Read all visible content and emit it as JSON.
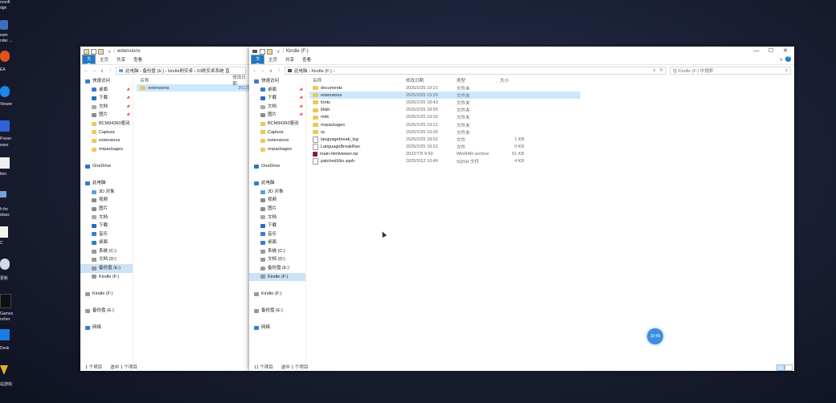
{
  "desktop": {
    "labels": [
      "rosoft",
      "dge",
      "eam",
      "nder ...",
      "EA",
      "Viewer",
      "Power",
      "wser",
      "tion",
      "h for",
      "dows",
      "C",
      "更新",
      "Games",
      "ncher",
      "Desk",
      "站游戏"
    ]
  },
  "left_window": {
    "title": "extensions",
    "ribbon_tabs": [
      "文件",
      "主页",
      "共享",
      "查看"
    ],
    "address": "此电脑 › 备份盘 (E:) › kindle刷安卓 › 03刷安卓系统 直",
    "col_name": "名称",
    "col_date": "修改日期",
    "rows": [
      {
        "name": "extensions",
        "date": "2017/"
      }
    ],
    "sidebar": [
      {
        "label": "快速访问",
        "icon": "star-icon",
        "color": "#3a7bd5",
        "pin": false,
        "level": 0,
        "sel": false
      },
      {
        "label": "桌面",
        "icon": "desktop-icon",
        "color": "#3a7bd5",
        "pin": true,
        "level": 1,
        "sel": false
      },
      {
        "label": "下载",
        "icon": "download-icon",
        "color": "#2b6cc4",
        "pin": true,
        "level": 1,
        "sel": false
      },
      {
        "label": "文档",
        "icon": "document-icon",
        "color": "#aaaaaa",
        "pin": true,
        "level": 1,
        "sel": false
      },
      {
        "label": "图片",
        "icon": "picture-icon",
        "color": "#8a8a8a",
        "pin": true,
        "level": 1,
        "sel": false
      },
      {
        "label": "BCM94360驱动",
        "icon": "folder-icon",
        "color": "#f0c65a",
        "pin": false,
        "level": 1,
        "sel": false
      },
      {
        "label": "Captura",
        "icon": "folder-icon",
        "color": "#f0c65a",
        "pin": false,
        "level": 1,
        "sel": false
      },
      {
        "label": "extensions",
        "icon": "folder-icon",
        "color": "#f0c65a",
        "pin": false,
        "level": 1,
        "sel": false
      },
      {
        "label": "mrpackages",
        "icon": "folder-icon",
        "color": "#f0c65a",
        "pin": false,
        "level": 1,
        "sel": false
      },
      {
        "label": "",
        "icon": "",
        "color": "",
        "pin": false,
        "level": 0,
        "sel": false
      },
      {
        "label": "OneDrive",
        "icon": "cloud-icon",
        "color": "#2a73c9",
        "pin": false,
        "level": 0,
        "sel": false
      },
      {
        "label": "",
        "icon": "",
        "color": "",
        "pin": false,
        "level": 0,
        "sel": false
      },
      {
        "label": "此电脑",
        "icon": "computer-icon",
        "color": "#3a7bd5",
        "pin": false,
        "level": 0,
        "sel": false
      },
      {
        "label": "3D 对象",
        "icon": "cube-icon",
        "color": "#5aa0e0",
        "pin": false,
        "level": 1,
        "sel": false
      },
      {
        "label": "视频",
        "icon": "video-icon",
        "color": "#8a8a8a",
        "pin": false,
        "level": 1,
        "sel": false
      },
      {
        "label": "图片",
        "icon": "picture-icon",
        "color": "#8a8a8a",
        "pin": false,
        "level": 1,
        "sel": false
      },
      {
        "label": "文档",
        "icon": "document-icon",
        "color": "#aaaaaa",
        "pin": false,
        "level": 1,
        "sel": false
      },
      {
        "label": "下载",
        "icon": "download-icon",
        "color": "#2b6cc4",
        "pin": false,
        "level": 1,
        "sel": false
      },
      {
        "label": "音乐",
        "icon": "music-icon",
        "color": "#3a7bd5",
        "pin": false,
        "level": 1,
        "sel": false
      },
      {
        "label": "桌面",
        "icon": "desktop-icon",
        "color": "#3a7bd5",
        "pin": false,
        "level": 1,
        "sel": false
      },
      {
        "label": "系统 (C:)",
        "icon": "drive-icon",
        "color": "#999999",
        "pin": false,
        "level": 1,
        "sel": false
      },
      {
        "label": "文档 (D:)",
        "icon": "drive-icon",
        "color": "#999999",
        "pin": false,
        "level": 1,
        "sel": false
      },
      {
        "label": "备份盘 (E:)",
        "icon": "drive-icon",
        "color": "#999999",
        "pin": false,
        "level": 1,
        "sel": true
      },
      {
        "label": "Kindle (F:)",
        "icon": "drive-icon",
        "color": "#999999",
        "pin": false,
        "level": 1,
        "sel": false
      },
      {
        "label": "",
        "icon": "",
        "color": "",
        "pin": false,
        "level": 0,
        "sel": false
      },
      {
        "label": "Kindle (F:)",
        "icon": "drive-icon",
        "color": "#999999",
        "pin": false,
        "level": 0,
        "sel": false
      },
      {
        "label": "",
        "icon": "",
        "color": "",
        "pin": false,
        "level": 0,
        "sel": false
      },
      {
        "label": "备份盘 (E:)",
        "icon": "drive-icon",
        "color": "#999999",
        "pin": false,
        "level": 0,
        "sel": false
      },
      {
        "label": "",
        "icon": "",
        "color": "",
        "pin": false,
        "level": 0,
        "sel": false
      },
      {
        "label": "网络",
        "icon": "network-icon",
        "color": "#3a7bd5",
        "pin": false,
        "level": 0,
        "sel": false
      }
    ],
    "status_count": "1 个项目",
    "status_selected": "选中 1 个项目"
  },
  "right_window": {
    "title": "Kindle (F:)",
    "ribbon_tabs": [
      "文件",
      "主页",
      "共享",
      "查看"
    ],
    "address": "此电脑 › Kindle (F:) ›",
    "search_placeholder": "在 Kindle (F:) 中搜索",
    "columns": {
      "name": "名称",
      "date": "修改日期",
      "type": "类型",
      "size": "大小"
    },
    "rows": [
      {
        "name": "documents",
        "date": "2025/2/25 19:21",
        "type": "文件夹",
        "size": "",
        "kind": "folder",
        "sel": false
      },
      {
        "name": "extensions",
        "date": "2025/2/25 19:30",
        "type": "文件夹",
        "size": "",
        "kind": "folder",
        "sel": true
      },
      {
        "name": "fonts",
        "date": "2025/2/25 18:43",
        "type": "文件夹",
        "size": "",
        "kind": "folder",
        "sel": false
      },
      {
        "name": "libkh",
        "date": "2025/2/25 18:55",
        "type": "文件夹",
        "size": "",
        "kind": "folder",
        "sel": false
      },
      {
        "name": "mkk",
        "date": "2025/2/25 19:00",
        "type": "文件夹",
        "size": "",
        "kind": "folder",
        "sel": false
      },
      {
        "name": "mrpackages",
        "date": "2025/2/25 19:21",
        "type": "文件夹",
        "size": "",
        "kind": "folder",
        "sel": false
      },
      {
        "name": "rp",
        "date": "2025/2/25 19:00",
        "type": "文件夹",
        "size": "",
        "kind": "folder",
        "sel": false
      },
      {
        "name": "languagebreak_log",
        "date": "2025/2/25 18:52",
        "type": "文件",
        "size": "1 KB",
        "kind": "file",
        "sel": false
      },
      {
        "name": "LanguageBreakRan",
        "date": "2025/2/25 18:52",
        "type": "文件",
        "size": "0 KB",
        "kind": "file",
        "sel": false
      },
      {
        "name": "main-htmlviewer.tar",
        "date": "2022/7/5 9:50",
        "type": "WinRAR archive",
        "size": "51 KB",
        "kind": "rar",
        "sel": false
      },
      {
        "name": "patchedUks.sqsh",
        "date": "2025/2/12 10:46",
        "type": "SQSH 文件",
        "size": "4 KB",
        "kind": "file",
        "sel": false
      }
    ],
    "sidebar": [
      {
        "label": "快速访问",
        "icon": "star-icon",
        "color": "#3a7bd5",
        "pin": false,
        "level": 0,
        "sel": false
      },
      {
        "label": "桌面",
        "icon": "desktop-icon",
        "color": "#3a7bd5",
        "pin": true,
        "level": 1,
        "sel": false
      },
      {
        "label": "下载",
        "icon": "download-icon",
        "color": "#2b6cc4",
        "pin": true,
        "level": 1,
        "sel": false
      },
      {
        "label": "文档",
        "icon": "document-icon",
        "color": "#aaaaaa",
        "pin": true,
        "level": 1,
        "sel": false
      },
      {
        "label": "图片",
        "icon": "picture-icon",
        "color": "#8a8a8a",
        "pin": true,
        "level": 1,
        "sel": false
      },
      {
        "label": "BCM94360驱动",
        "icon": "folder-icon",
        "color": "#f0c65a",
        "pin": false,
        "level": 1,
        "sel": false
      },
      {
        "label": "Captura",
        "icon": "folder-icon",
        "color": "#f0c65a",
        "pin": false,
        "level": 1,
        "sel": false
      },
      {
        "label": "extensions",
        "icon": "folder-icon",
        "color": "#f0c65a",
        "pin": false,
        "level": 1,
        "sel": false
      },
      {
        "label": "mrpackages",
        "icon": "folder-icon",
        "color": "#f0c65a",
        "pin": false,
        "level": 1,
        "sel": false
      },
      {
        "label": "",
        "icon": "",
        "color": "",
        "pin": false,
        "level": 0,
        "sel": false
      },
      {
        "label": "OneDrive",
        "icon": "cloud-icon",
        "color": "#2a73c9",
        "pin": false,
        "level": 0,
        "sel": false
      },
      {
        "label": "",
        "icon": "",
        "color": "",
        "pin": false,
        "level": 0,
        "sel": false
      },
      {
        "label": "此电脑",
        "icon": "computer-icon",
        "color": "#3a7bd5",
        "pin": false,
        "level": 0,
        "sel": false
      },
      {
        "label": "3D 对象",
        "icon": "cube-icon",
        "color": "#5aa0e0",
        "pin": false,
        "level": 1,
        "sel": false
      },
      {
        "label": "视频",
        "icon": "video-icon",
        "color": "#8a8a8a",
        "pin": false,
        "level": 1,
        "sel": false
      },
      {
        "label": "图片",
        "icon": "picture-icon",
        "color": "#8a8a8a",
        "pin": false,
        "level": 1,
        "sel": false
      },
      {
        "label": "文档",
        "icon": "document-icon",
        "color": "#aaaaaa",
        "pin": false,
        "level": 1,
        "sel": false
      },
      {
        "label": "下载",
        "icon": "download-icon",
        "color": "#2b6cc4",
        "pin": false,
        "level": 1,
        "sel": false
      },
      {
        "label": "音乐",
        "icon": "music-icon",
        "color": "#3a7bd5",
        "pin": false,
        "level": 1,
        "sel": false
      },
      {
        "label": "桌面",
        "icon": "desktop-icon",
        "color": "#3a7bd5",
        "pin": false,
        "level": 1,
        "sel": false
      },
      {
        "label": "系统 (C:)",
        "icon": "drive-icon",
        "color": "#999999",
        "pin": false,
        "level": 1,
        "sel": false
      },
      {
        "label": "文档 (D:)",
        "icon": "drive-icon",
        "color": "#999999",
        "pin": false,
        "level": 1,
        "sel": false
      },
      {
        "label": "备份盘 (E:)",
        "icon": "drive-icon",
        "color": "#999999",
        "pin": false,
        "level": 1,
        "sel": false
      },
      {
        "label": "Kindle (F:)",
        "icon": "drive-icon",
        "color": "#999999",
        "pin": false,
        "level": 1,
        "sel": true
      },
      {
        "label": "",
        "icon": "",
        "color": "",
        "pin": false,
        "level": 0,
        "sel": false
      },
      {
        "label": "Kindle (F:)",
        "icon": "drive-icon",
        "color": "#999999",
        "pin": false,
        "level": 0,
        "sel": false
      },
      {
        "label": "",
        "icon": "",
        "color": "",
        "pin": false,
        "level": 0,
        "sel": false
      },
      {
        "label": "备份盘 (E:)",
        "icon": "drive-icon",
        "color": "#999999",
        "pin": false,
        "level": 0,
        "sel": false
      },
      {
        "label": "",
        "icon": "",
        "color": "",
        "pin": false,
        "level": 0,
        "sel": false
      },
      {
        "label": "网络",
        "icon": "network-icon",
        "color": "#3a7bd5",
        "pin": false,
        "level": 0,
        "sel": false
      }
    ],
    "status_count": "11 个项目",
    "status_selected": "选中 1 个项目"
  },
  "overlay": {
    "badge_text": "10:46"
  },
  "colors": {
    "accent": "#1979ca",
    "selection": "#cce8ff",
    "folder": "#f0c65a"
  }
}
